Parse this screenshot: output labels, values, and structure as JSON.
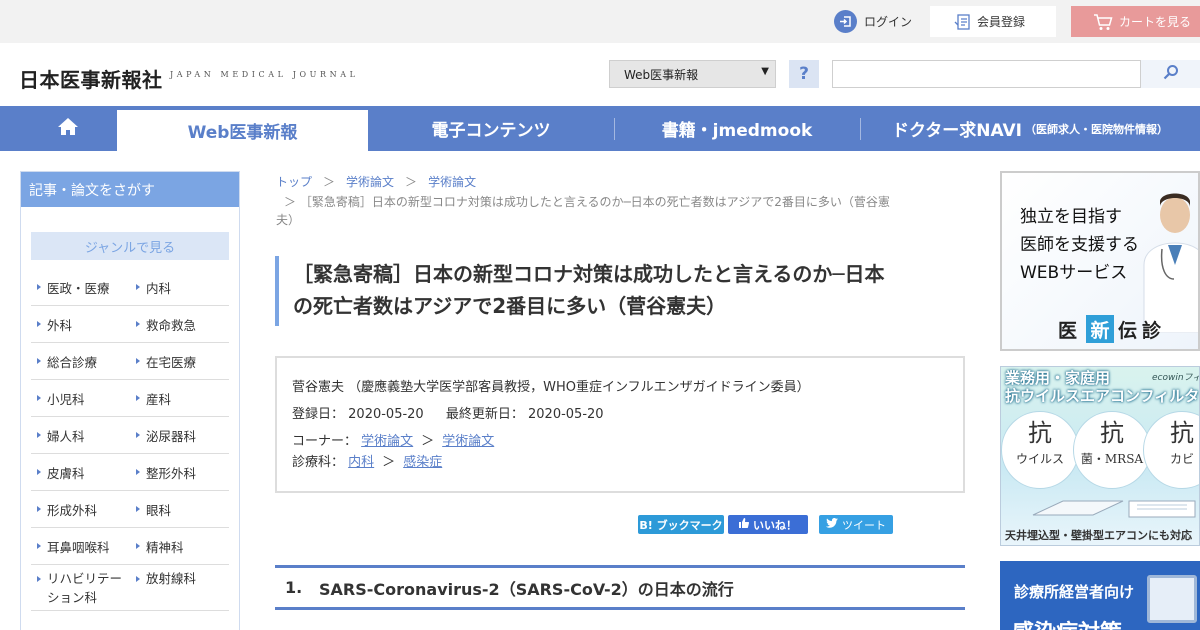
{
  "topbar": {
    "login_label": "ログイン",
    "member_label": "会員登録",
    "cart_label": "カートを見る"
  },
  "header": {
    "logo_jp": "日本医事新報社",
    "logo_en": "JAPAN MEDICAL JOURNAL",
    "select_value": "Web医事新報",
    "help_label": "?",
    "search_value": ""
  },
  "nav": {
    "items": [
      {
        "label": "Web医事新報"
      },
      {
        "label": "電子コンテンツ"
      },
      {
        "label": "書籍・jmedmook"
      },
      {
        "label": "ドクター求NAVI",
        "sub": "（医師求人・医院物件情報）"
      }
    ]
  },
  "sidebar": {
    "title": "記事・論文をさがす",
    "genre_label": "ジャンルで見る",
    "items": [
      "医政・医療",
      "内科",
      "外科",
      "救命救急",
      "総合診療",
      "在宅医療",
      "小児科",
      "産科",
      "婦人科",
      "泌尿器科",
      "皮膚科",
      "整形外科",
      "形成外科",
      "眼科",
      "耳鼻咽喉科",
      "精神科",
      "リハビリテーション科",
      "放射線科"
    ]
  },
  "breadcrumb": {
    "items": [
      "トップ",
      "学術論文",
      "学術論文"
    ],
    "sep": "＞",
    "current_1": "＞ ［緊急寄稿］日本の新型コロナ対策は成功したと言えるのか─日本の死亡者数はアジアで2番目に多い（菅谷憲",
    "current_2": "夫）"
  },
  "article": {
    "title_line1": "［緊急寄稿］日本の新型コロナ対策は成功したと言えるのか─日本",
    "title_line2": "の死亡者数はアジアで2番目に多い（菅谷憲夫）",
    "author": "菅谷憲夫 （慶應義塾大学医学部客員教授，WHO重症インフルエンザガイドライン委員）",
    "registered_label": "登録日：",
    "registered_date": "2020-05-20",
    "updated_label": "最終更新日：",
    "updated_date": "2020-05-20",
    "corner_label": "コーナー：",
    "corner_link1": "学術論文",
    "corner_link2": "学術論文",
    "dept_label": "診療科：",
    "dept_link1": "内科",
    "dept_link2": "感染症",
    "gt": "＞"
  },
  "share": {
    "hatena": "B! ブックマーク",
    "facebook": "いいね！",
    "twitter": "ツイート"
  },
  "section": {
    "number": "1.",
    "title": "SARS-Coronavirus-2（SARS-CoV-2）の日本の流行"
  },
  "ads": {
    "ad1_lines": [
      "独立を目指す",
      "医師を支援する",
      "WEBサービス"
    ],
    "ad1_brand": [
      "医",
      "新",
      "伝",
      "診"
    ],
    "ad2_headline_1": "業務用・家庭用",
    "ad2_headline_2": "抗ウイルスエアコンフィルター",
    "ad2_brand": "ecowinフィルター",
    "ad2_badges": [
      {
        "big": "抗",
        "small": "ウイルス"
      },
      {
        "big": "抗",
        "small": "菌・MRSA"
      },
      {
        "big": "抗",
        "small": "カビ"
      }
    ],
    "ad2_footer": "天井埋込型・壁掛型エアコンにも対応",
    "ad3_line1": "診療所経営者向け",
    "ad3_line2": "感染症対策"
  },
  "colors": {
    "brand_blue": "#5a7fc9",
    "sidebar_header": "#7ba5e3",
    "cart_pink": "#e89a9a"
  }
}
